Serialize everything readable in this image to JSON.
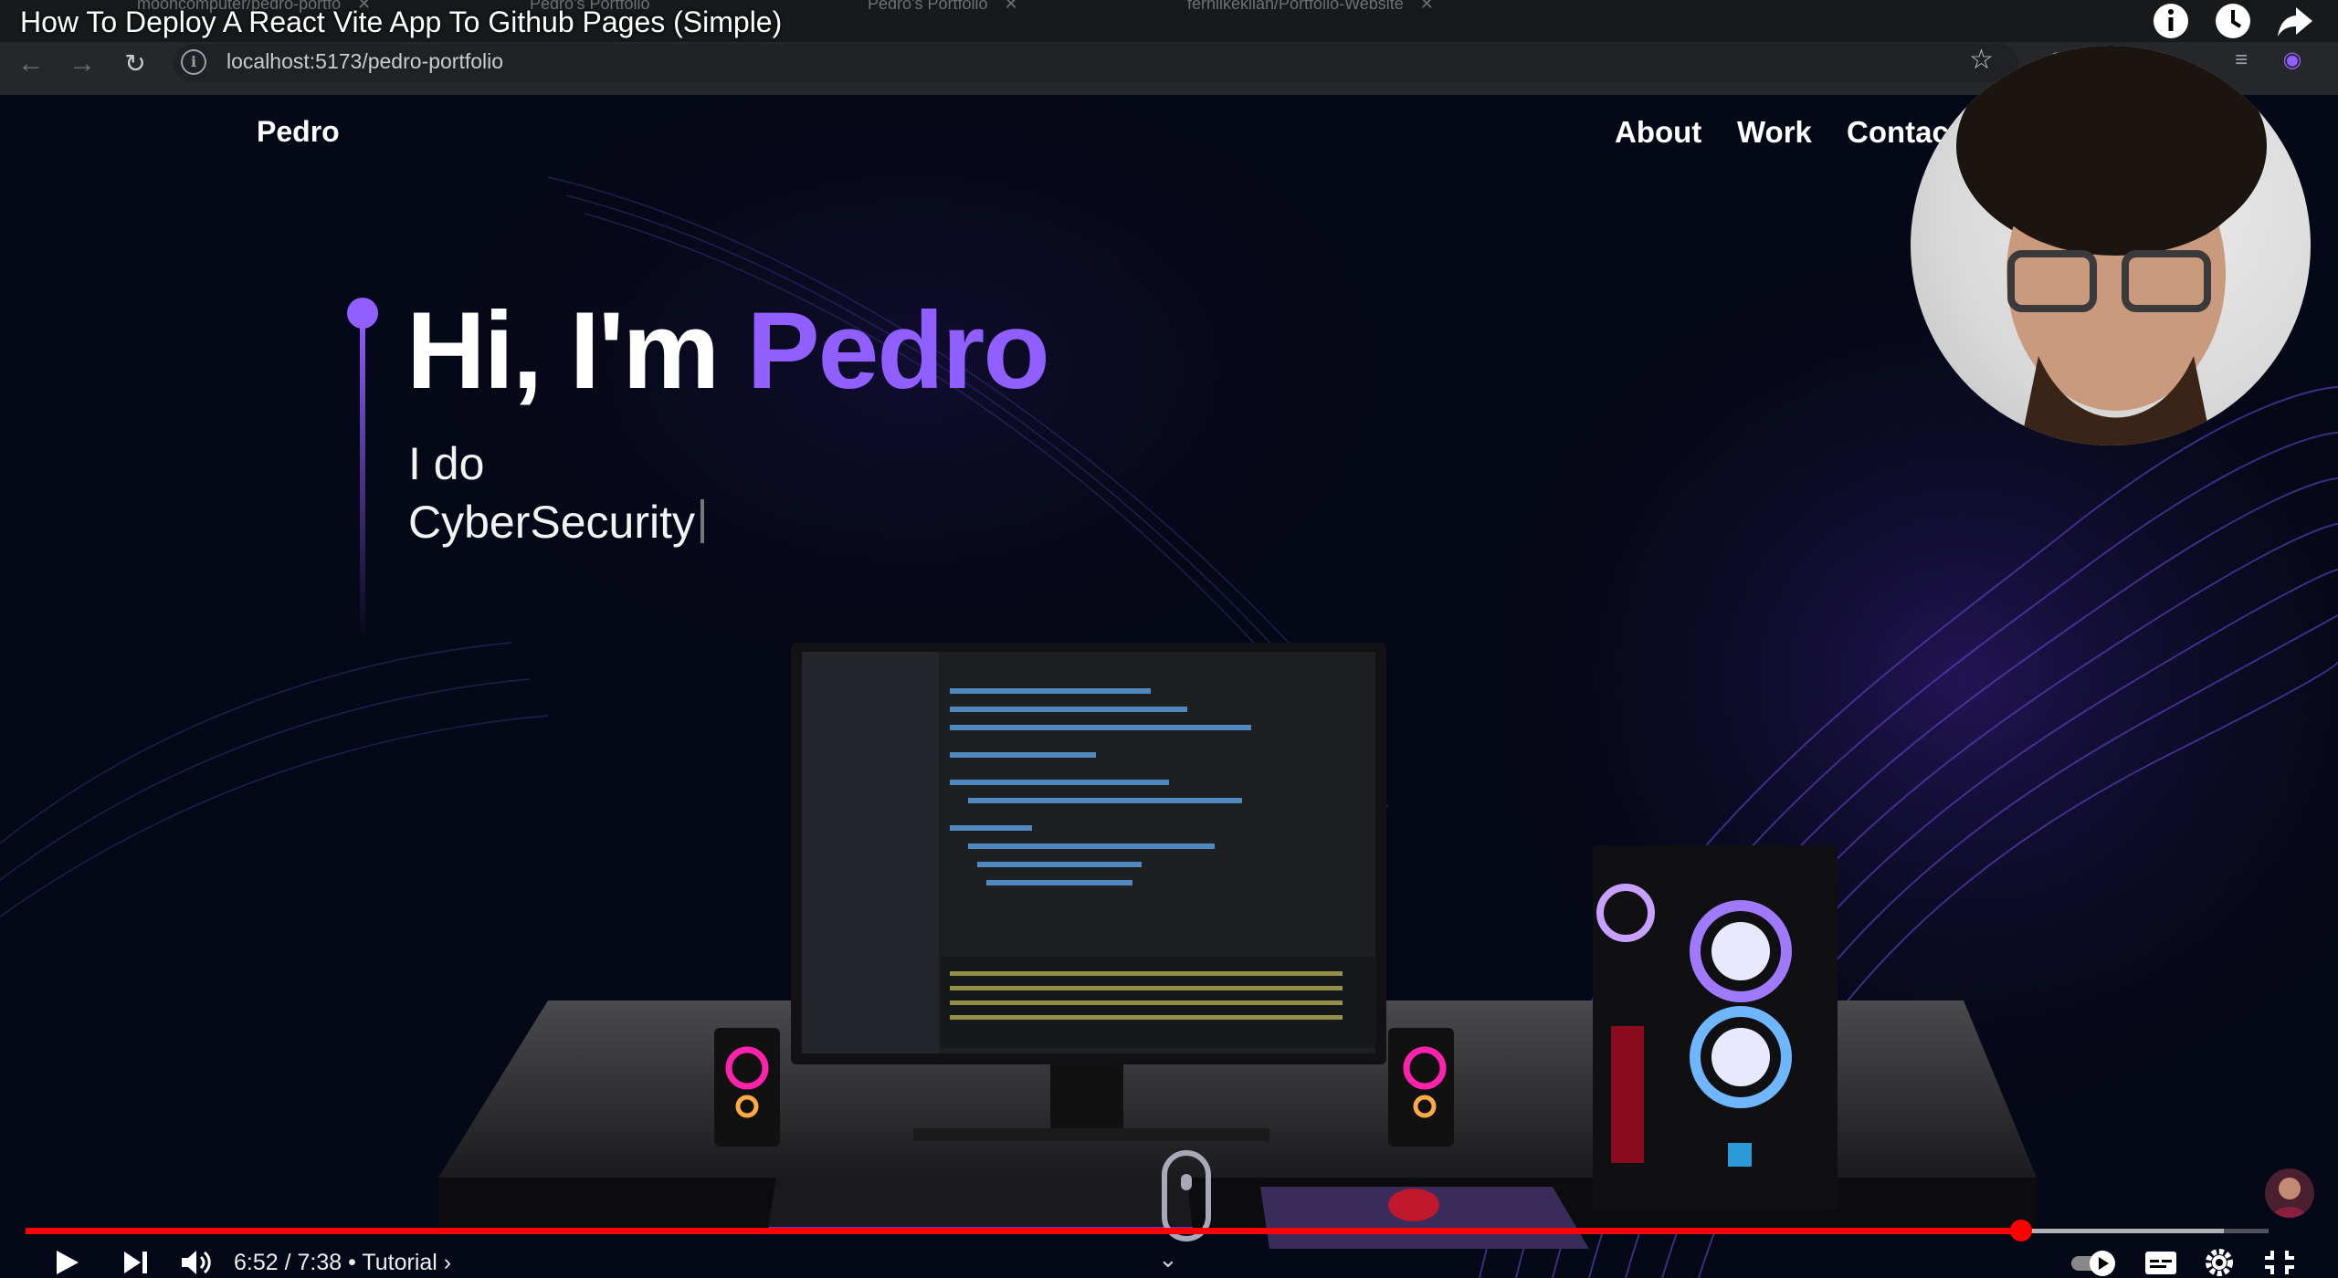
{
  "browser": {
    "tabs": [
      {
        "title": "mooncomputer/pedro-portfo"
      },
      {
        "title": "Pedro's Portfolio"
      },
      {
        "title": "Pedro's Portfolio"
      },
      {
        "title": "ferhlikeklian/Portfolio-Website"
      }
    ],
    "url": "localhost:5173/pedro-portfolio"
  },
  "video": {
    "title": "How To Deploy A React Vite App To Github Pages (Simple)",
    "current_time": "6:52",
    "duration": "7:38",
    "chapter": "Tutorial",
    "progress": 0.8895,
    "buffered": 0.98
  },
  "site": {
    "brand": "Pedro",
    "nav": [
      "About",
      "Work",
      "Contac"
    ],
    "hero": {
      "greeting": "Hi, I'm ",
      "name": "Pedro",
      "line1": "I do",
      "line2": "CyberSecurity"
    }
  },
  "colors": {
    "accent": "#915eff",
    "background": "#050816",
    "progress": "#ff0000"
  },
  "icons": [
    "back-arrow-icon",
    "forward-arrow-icon",
    "reload-icon",
    "site-info-icon",
    "bookmark-star-icon",
    "info-icon",
    "watch-later-icon",
    "share-icon",
    "play-icon",
    "next-icon",
    "volume-icon",
    "autoplay-toggle-icon",
    "subtitles-icon",
    "settings-icon",
    "exit-fullscreen-icon",
    "mouse-scroll-icon"
  ]
}
